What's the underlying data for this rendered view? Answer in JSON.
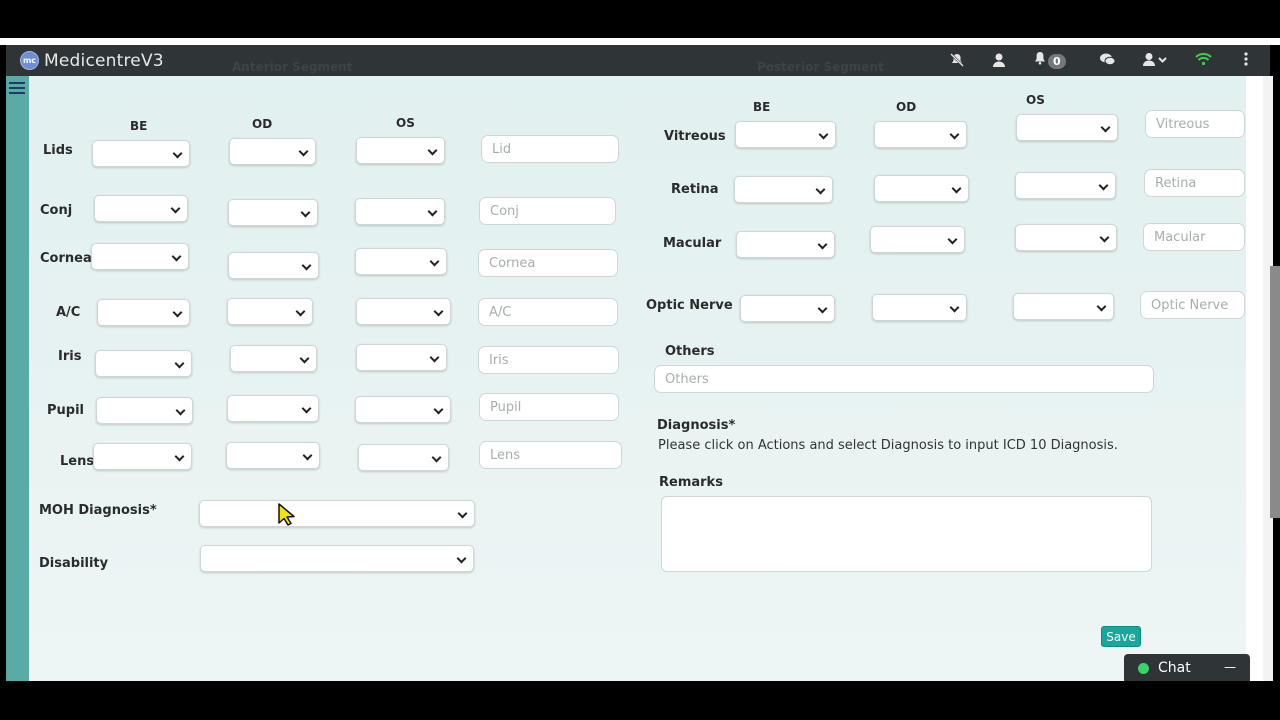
{
  "app": {
    "brand_logo_text": "mc",
    "title": "MedicentreV3",
    "notification_count": "0"
  },
  "ghost": {
    "left": "Anterior Segment",
    "right": "Posterior Segment"
  },
  "anterior": {
    "headers": {
      "be": "BE",
      "od": "OD",
      "os": "OS"
    },
    "rows": [
      {
        "label": "Lids",
        "placeholder": "Lid"
      },
      {
        "label": "Conj",
        "placeholder": "Conj"
      },
      {
        "label": "Cornea",
        "placeholder": "Cornea"
      },
      {
        "label": "A/C",
        "placeholder": "A/C"
      },
      {
        "label": "Iris",
        "placeholder": "Iris"
      },
      {
        "label": "Pupil",
        "placeholder": "Pupil"
      },
      {
        "label": "Lens",
        "placeholder": "Lens"
      }
    ],
    "moh_label": "MOH Diagnosis*",
    "disability_label": "Disability"
  },
  "posterior": {
    "headers": {
      "be": "BE",
      "od": "OD",
      "os": "OS"
    },
    "rows": [
      {
        "label": "Vitreous",
        "placeholder": "Vitreous"
      },
      {
        "label": "Retina",
        "placeholder": "Retina"
      },
      {
        "label": "Macular",
        "placeholder": "Macular"
      },
      {
        "label": "Optic Nerve",
        "placeholder": "Optic Nerve"
      }
    ],
    "others_label": "Others",
    "others_placeholder": "Others",
    "diagnosis_label": "Diagnosis*",
    "diagnosis_text": "Please click on Actions and select Diagnosis to input ICD 10 Diagnosis.",
    "remarks_label": "Remarks"
  },
  "buttons": {
    "save": "Save"
  },
  "chat": {
    "label": "Chat",
    "minimize": "—"
  }
}
